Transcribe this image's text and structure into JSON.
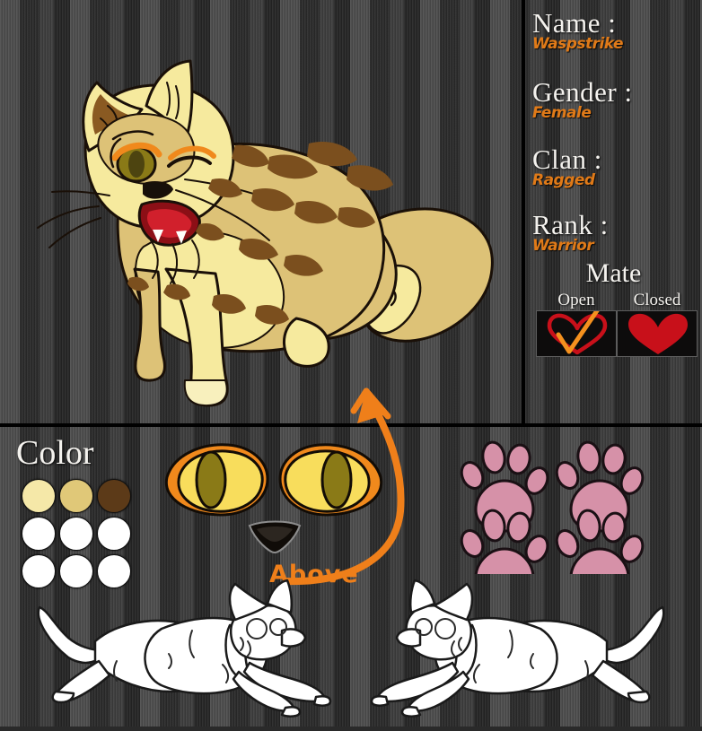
{
  "info": {
    "fields": [
      {
        "label": "Name :",
        "value": "Waspstrike"
      },
      {
        "label": "Gender :",
        "value": "Female"
      },
      {
        "label": "Clan :",
        "value": "Ragged"
      },
      {
        "label": "Rank :",
        "value": "Warrior"
      }
    ],
    "mate": {
      "heading": "Mate",
      "options": [
        {
          "label": "Open",
          "state": "checked"
        },
        {
          "label": "Closed",
          "state": "unchecked"
        }
      ]
    }
  },
  "palette": {
    "heading": "Color",
    "swatches": [
      "#f5e8a8",
      "#e0c878",
      "#5c3a18",
      "#ffffff",
      "#ffffff",
      "#ffffff",
      "#ffffff",
      "#ffffff",
      "#ffffff"
    ]
  },
  "annotation": {
    "above_label": "Above"
  },
  "colors": {
    "accent_orange": "#e07a18",
    "heading_white": "#f4f2ee",
    "heart_red": "#c8101a",
    "check_orange": "#f5911e",
    "paw_pink": "#d691a8",
    "pelt_tan": "#ddc277",
    "pelt_cream": "#f6ea9e",
    "pelt_stripe": "#7b4f1e",
    "eye_iris": "#f8dd5c",
    "eye_rim": "#f08a1c",
    "eye_pupil": "#8a7a17",
    "background_dark": "#2b2b2b",
    "background_light": "#4e4e4e"
  }
}
